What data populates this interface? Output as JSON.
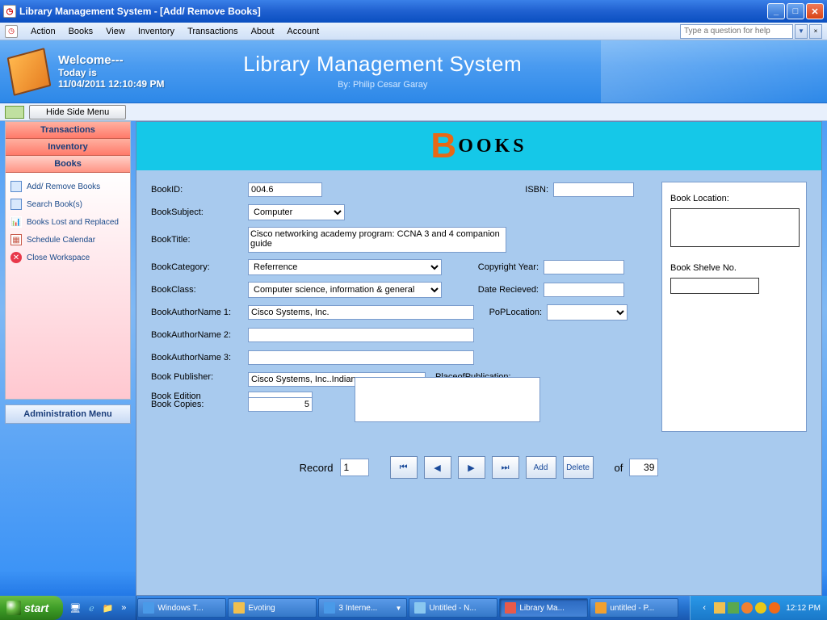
{
  "window": {
    "title": "Library Management System - [Add/ Remove Books]"
  },
  "menubar": {
    "items": [
      "Action",
      "Books",
      "View",
      "Inventory",
      "Transactions",
      "About",
      "Account"
    ],
    "help_placeholder": "Type a question for help"
  },
  "banner": {
    "welcome": "Welcome---",
    "today_label": "Today is",
    "datetime": "11/04/2011 12:10:49 PM",
    "title": "Library Management System",
    "byline": "By: Philip Cesar Garay"
  },
  "toggle": {
    "hide_label": "Hide Side Menu"
  },
  "sidebar": {
    "tabs": {
      "transactions": "Transactions",
      "inventory": "Inventory",
      "books": "Books"
    },
    "items": {
      "addremove": "Add/ Remove Books",
      "search": "Search Book(s)",
      "lost": "Books Lost and Replaced",
      "calendar": "Schedule Calendar",
      "close": "Close Workspace"
    },
    "admin": "Administration Menu"
  },
  "books_header": {
    "big": "B",
    "rest": "OOKS"
  },
  "form": {
    "labels": {
      "bookid": "BookID:",
      "isbn": "ISBN:",
      "subject": "BookSubject:",
      "title": "BookTitle:",
      "category": "BookCategory:",
      "copyright": "Copyright Year:",
      "class": "BookClass:",
      "received": "Date Recieved:",
      "author1": "BookAuthorName 1:",
      "poploc": "PoPLocation:",
      "author2": "BookAuthorName 2:",
      "author3": "BookAuthorName 3:",
      "publisher": "Book Publisher:",
      "pop": "PlaceofPublication:",
      "edition": "Book Edition",
      "copies": "Book Copies:"
    },
    "values": {
      "bookid": "004.6",
      "isbn": "",
      "subject": "Computer",
      "title": "Cisco networking academy program: CCNA 3 and 4 companion guide",
      "category": "Referrence",
      "copyright": "",
      "class": "Computer science, information & general",
      "received": "",
      "author1": "Cisco Systems, Inc.",
      "poploc": "",
      "author2": "",
      "author3": "",
      "publisher": "Cisco Systems, Inc..Indiana",
      "pop": "",
      "edition": "",
      "copies": "5"
    },
    "right": {
      "location_label": "Book Location:",
      "shelve_label": "Book Shelve No."
    }
  },
  "nav": {
    "record_label": "Record",
    "current": "1",
    "of_label": "of",
    "total": "39",
    "add": "Add",
    "delete": "Delete"
  },
  "taskbar": {
    "start": "start",
    "items": [
      "Windows T...",
      "Evoting",
      "3 Interne...",
      "Untitled - N...",
      "Library Ma...",
      "untitled - P..."
    ],
    "clock": "12:12 PM"
  }
}
